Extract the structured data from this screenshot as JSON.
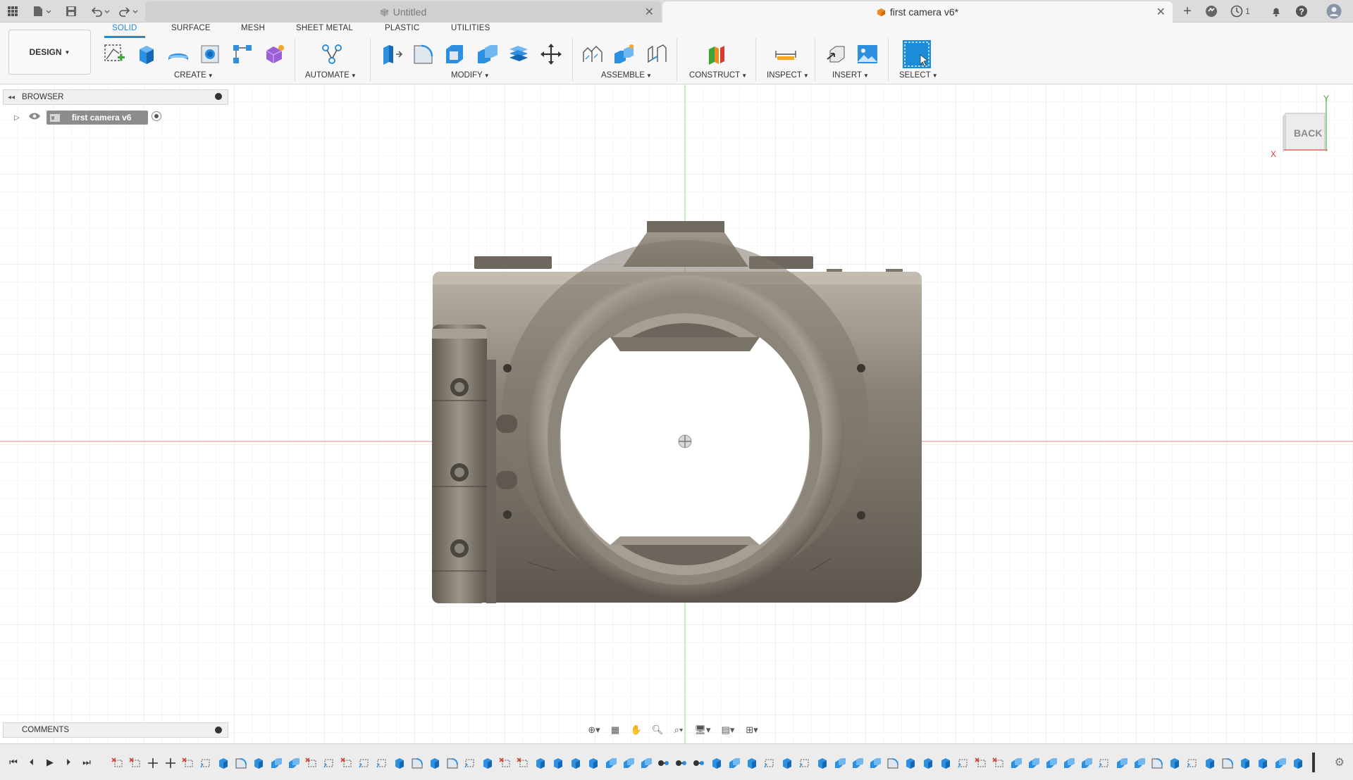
{
  "titlebar": {
    "tabs": [
      {
        "title": "Untitled",
        "active": false
      },
      {
        "title": "first camera v6*",
        "active": true
      }
    ],
    "notifications_count": "1"
  },
  "toolbar": {
    "workspace_button": "DESIGN",
    "workspace_tabs": [
      "SOLID",
      "SURFACE",
      "MESH",
      "SHEET METAL",
      "PLASTIC",
      "UTILITIES"
    ],
    "active_tab": "SOLID",
    "groups": [
      "CREATE",
      "AUTOMATE",
      "MODIFY",
      "ASSEMBLE",
      "CONSTRUCT",
      "INSPECT",
      "INSERT",
      "SELECT"
    ]
  },
  "browser": {
    "header": "BROWSER",
    "root_component": "first camera v6"
  },
  "comments": {
    "header": "COMMENTS"
  },
  "viewcube": {
    "face": "BACK",
    "axis_x": "X",
    "axis_y": "Y"
  },
  "timeline": {
    "feature_count": 68
  },
  "colors": {
    "accent": "#1a8cd8",
    "body_metal": "#8a8377",
    "grid": "#e4e4e4"
  }
}
